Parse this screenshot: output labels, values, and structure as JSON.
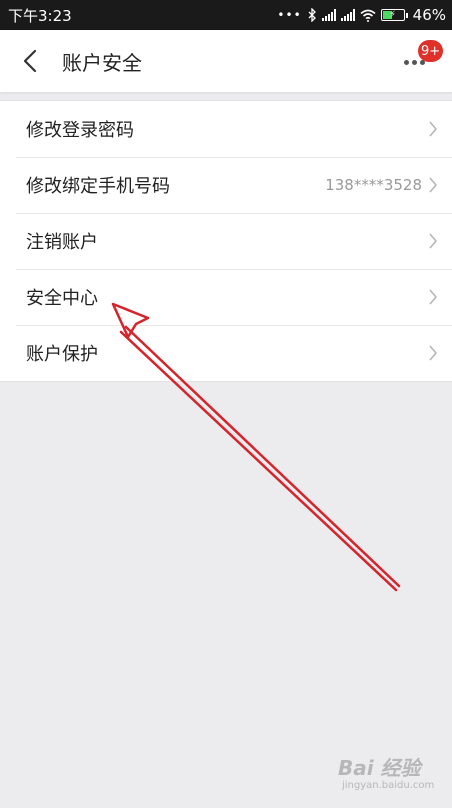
{
  "status_bar": {
    "time": "下午3:23",
    "dots": "•••",
    "battery": "46%"
  },
  "header": {
    "title": "账户安全",
    "badge": "9+"
  },
  "menu": [
    {
      "label": "修改登录密码",
      "value": ""
    },
    {
      "label": "修改绑定手机号码",
      "value": "138****3528"
    },
    {
      "label": "注销账户",
      "value": ""
    },
    {
      "label": "安全中心",
      "value": ""
    },
    {
      "label": "账户保护",
      "value": ""
    }
  ],
  "watermark": {
    "brand": "Bai 经验",
    "url": "jingyan.baidu.com"
  },
  "colors": {
    "annotation_arrow": "#d5242b",
    "badge": "#e0302a",
    "page_background": "#ececef"
  }
}
